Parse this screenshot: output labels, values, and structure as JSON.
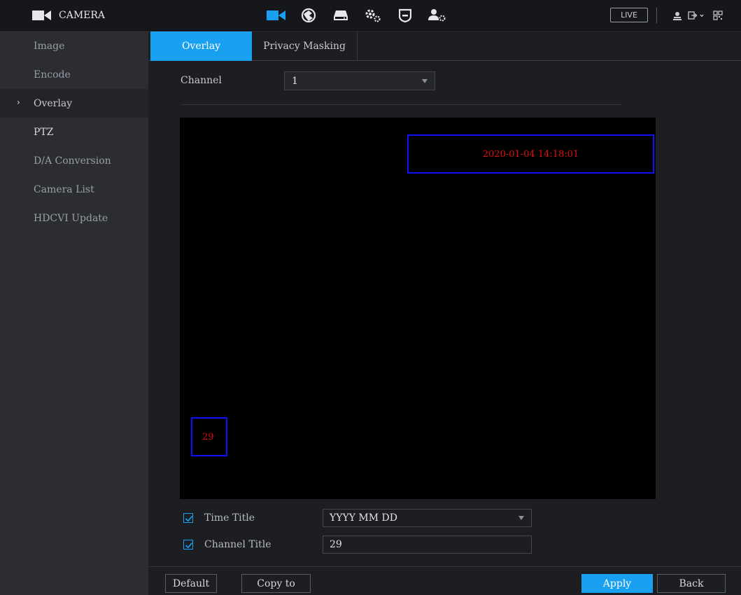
{
  "header": {
    "title": "CAMERA",
    "live_label": "LIVE",
    "nav_icons": [
      "camera-icon",
      "network-icon",
      "storage-icon",
      "system-settings-icon",
      "shield-icon",
      "account-icon"
    ],
    "right_icons": [
      "user-icon",
      "logout-icon",
      "qr-code-icon"
    ]
  },
  "sidebar": {
    "items": [
      {
        "label": "Image"
      },
      {
        "label": "Encode"
      },
      {
        "label": "Overlay"
      },
      {
        "label": "PTZ"
      },
      {
        "label": "D/A Conversion"
      },
      {
        "label": "Camera List"
      },
      {
        "label": "HDCVI Update"
      }
    ],
    "active_chevron": "›"
  },
  "tabs": [
    {
      "label": "Overlay",
      "active": true
    },
    {
      "label": "Privacy Masking",
      "active": false
    }
  ],
  "channel": {
    "label": "Channel",
    "value": "1"
  },
  "preview": {
    "time_overlay": "2020-01-04 14:18:01",
    "channel_overlay": "29"
  },
  "options": {
    "time_title": {
      "label": "Time Title",
      "checked": true,
      "value": "YYYY MM DD"
    },
    "channel_title": {
      "label": "Channel Title",
      "checked": true,
      "value": "29"
    }
  },
  "footer": {
    "default_label": "Default",
    "copy_label": "Copy to",
    "apply_label": "Apply",
    "back_label": "Back"
  },
  "colors": {
    "accent": "#1aa0f0",
    "overlay_box": "#1010ff",
    "overlay_text": "#e01010"
  }
}
